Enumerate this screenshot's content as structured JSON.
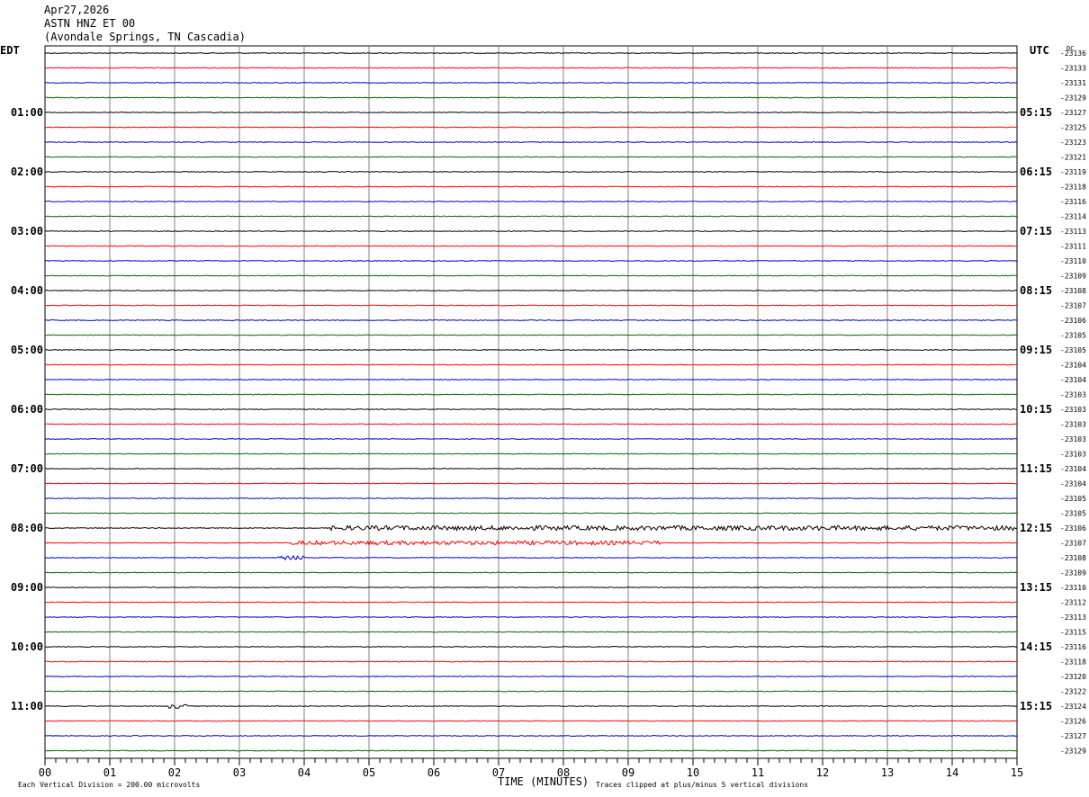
{
  "header": {
    "date": "Apr27,2026",
    "station": "ASTN HNZ ET 00",
    "location": "(Avondale Springs, TN Cascadia)"
  },
  "left_zone": "EDT",
  "right_zone": "UTC",
  "dc_label": "DC",
  "footer": {
    "scale_note": "Each Vertical Division =  200.00 microvolts",
    "clip_note": "Traces clipped at plus/minus 5 vertical divisions"
  },
  "colors": {
    "trace_cycle": [
      "#000000",
      "#ff0000",
      "#0000cc",
      "#006600"
    ],
    "grid": "#808080"
  },
  "chart_data": {
    "type": "line",
    "title": "ASTN HNZ ET 00",
    "xlabel": "TIME (MINUTES)",
    "ylabel": "",
    "xlim": [
      0,
      15
    ],
    "x_ticks": [
      "00",
      "01",
      "02",
      "03",
      "04",
      "05",
      "06",
      "07",
      "08",
      "09",
      "10",
      "11",
      "12",
      "13",
      "14",
      "15"
    ],
    "rows_per_hour": 4,
    "row_count": 48,
    "left_hour_labels": [
      "01:00",
      "02:00",
      "03:00",
      "04:00",
      "05:00",
      "06:00",
      "07:00",
      "08:00",
      "09:00",
      "10:00",
      "11:00"
    ],
    "right_hour_labels": [
      "05:15",
      "06:15",
      "07:15",
      "08:15",
      "09:15",
      "10:15",
      "11:15",
      "12:15",
      "13:15",
      "14:15",
      "15:15"
    ],
    "dc_offsets": [
      "-23136",
      "-23133",
      "-23131",
      "-23129",
      "-23127",
      "-23125",
      "-23123",
      "-23121",
      "-23119",
      "-23118",
      "-23116",
      "-23114",
      "-23113",
      "-23111",
      "-23110",
      "-23109",
      "-23108",
      "-23107",
      "-23106",
      "-23105",
      "-23105",
      "-23104",
      "-23104",
      "-23103",
      "-23103",
      "-23103",
      "-23103",
      "-23103",
      "-23104",
      "-23104",
      "-23105",
      "-23105",
      "-23106",
      "-23107",
      "-23108",
      "-23109",
      "-23110",
      "-23112",
      "-23113",
      "-23115",
      "-23116",
      "-23118",
      "-23120",
      "-23122",
      "-23124",
      "-23126",
      "-23127",
      "-23129"
    ],
    "events": [
      {
        "row": 32,
        "start_min": 4.4,
        "end_min": 15,
        "amplitude": 0.35
      },
      {
        "row": 33,
        "start_min": 3.8,
        "end_min": 9.5,
        "amplitude": 0.3
      },
      {
        "row": 34,
        "start_min": 3.6,
        "end_min": 4.0,
        "amplitude": 0.3
      },
      {
        "row": 44,
        "start_min": 1.9,
        "end_min": 2.2,
        "amplitude": 0.35
      }
    ]
  }
}
